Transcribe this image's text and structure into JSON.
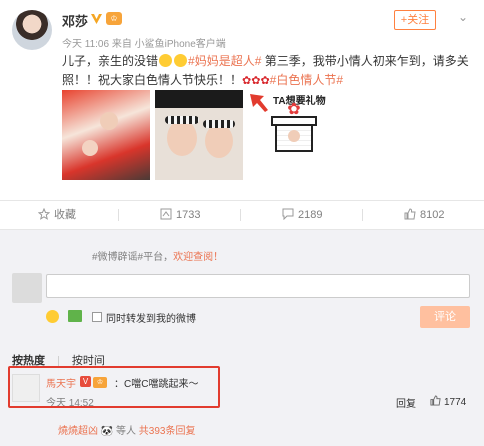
{
  "post": {
    "username": "邓莎",
    "follow_label": "+关注",
    "meta": "今天 11:06 来自 小鲨鱼iPhone客户端",
    "text_line1_a": "儿子，亲生的没错",
    "text_line1_tag": "#妈妈是超人#",
    "text_line1_b": " 第三季，我带小情人初来乍到，请多关",
    "text_line2_a": "照！！祝大家白色情人节快乐！！",
    "text_line2_tag": "#白色情人节#",
    "photo3_caption": "TA想要礼物"
  },
  "actions": {
    "favorite": "收藏",
    "repost": "1733",
    "comment": "2189",
    "like": "8102"
  },
  "comment_box": {
    "notice_prefix": "#微博辟谣#平台，",
    "notice_link": "欢迎查阅！",
    "repost_label": "同时转发到我的微博",
    "submit_label": "评论"
  },
  "sort_tabs": [
    "按热度",
    "按时间"
  ],
  "comment": {
    "user": "馬天宇",
    "text": "：C噹C噹跳起来～",
    "time": "今天 14:52",
    "reply_label": "回复",
    "like_count": "1774"
  },
  "reply_summary": {
    "users": "燒燒超凶",
    "middle": "等人 ",
    "count": "共393条回复"
  },
  "colors": {
    "accent": "#eb7350",
    "highlight": "#e23b2e",
    "submit_disabled": "#ffc09f"
  }
}
